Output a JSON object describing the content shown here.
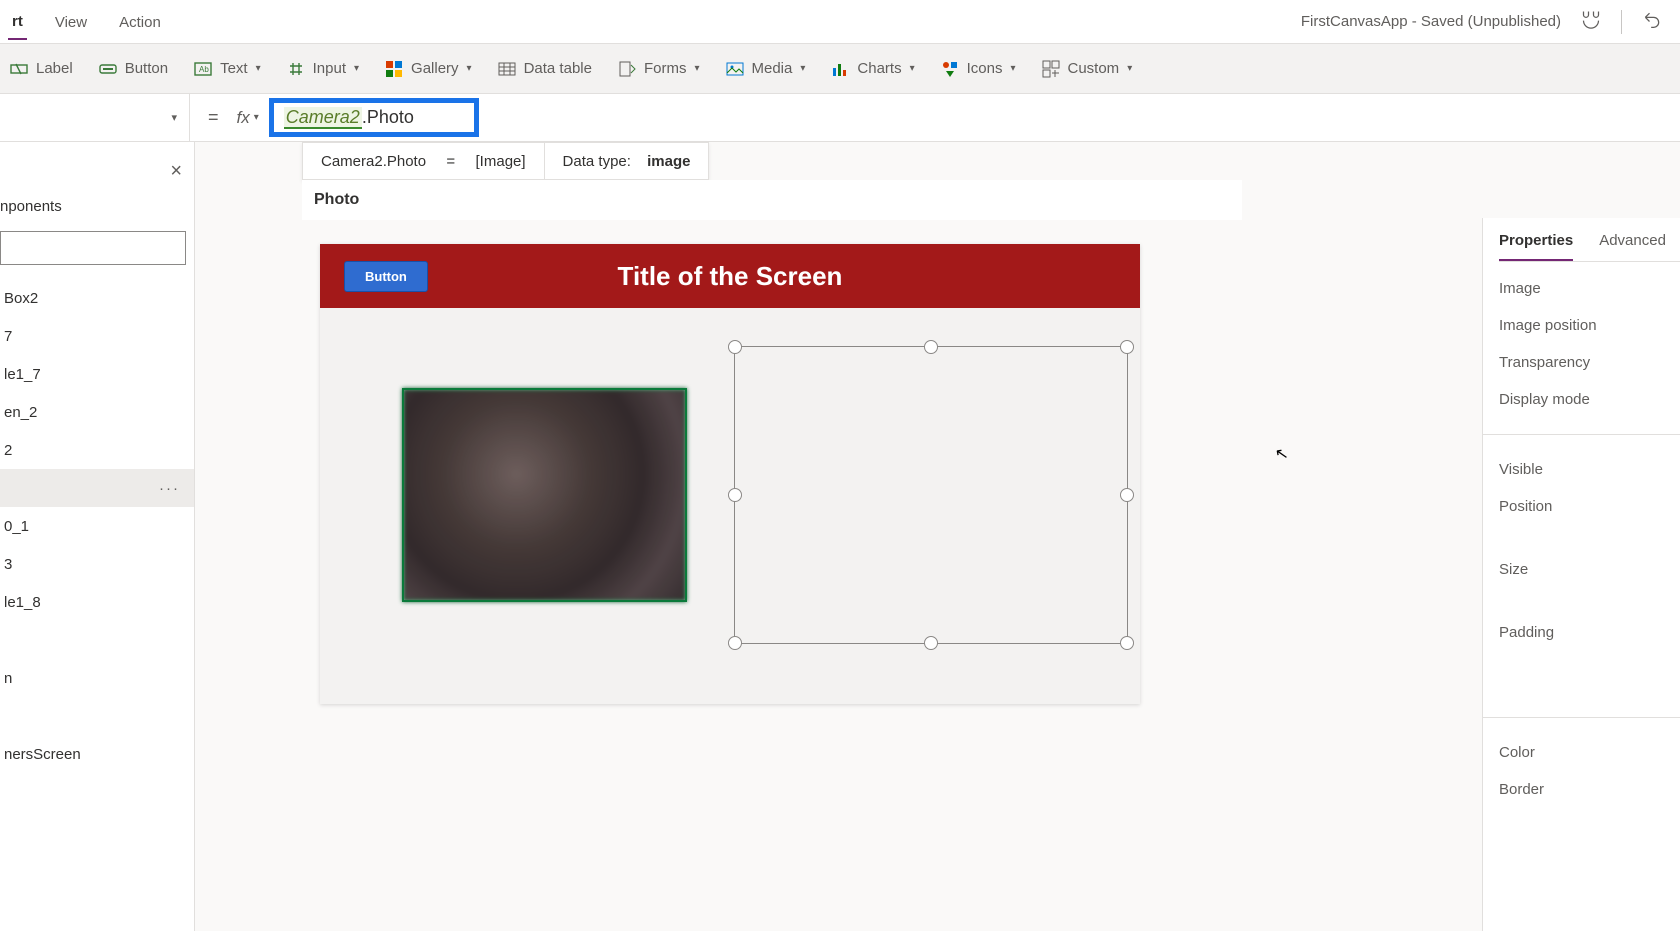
{
  "menubar": {
    "tabs": [
      "rt",
      "View",
      "Action"
    ],
    "app_title": "FirstCanvasApp - Saved (Unpublished)"
  },
  "ribbon": {
    "label": "Label",
    "button": "Button",
    "text": "Text",
    "input": "Input",
    "gallery": "Gallery",
    "datatable": "Data table",
    "forms": "Forms",
    "media": "Media",
    "charts": "Charts",
    "icons": "Icons",
    "custom": "Custom"
  },
  "formula": {
    "equals": "=",
    "fx": "fx",
    "token_obj": "Camera2",
    "token_prop": ".Photo"
  },
  "intellisense": {
    "expr": "Camera2.Photo",
    "eq": "=",
    "result": "[Image]",
    "datatype_label": "Data type:",
    "datatype_value": "image"
  },
  "section_header": "Photo",
  "tree": {
    "tab_label": "nponents",
    "items": [
      "Box2",
      "7",
      "le1_7",
      "en_2",
      "2",
      "",
      "0_1",
      "3",
      "le1_8",
      "",
      "n",
      "",
      "nersScreen"
    ],
    "selected_index": 5
  },
  "canvas": {
    "screen_title": "Title of the Screen",
    "button_label": "Button"
  },
  "properties": {
    "tabs": {
      "properties": "Properties",
      "advanced": "Advanced"
    },
    "items_a": [
      "Image",
      "Image position",
      "Transparency",
      "Display mode"
    ],
    "items_b": [
      "Visible",
      "Position",
      "Size",
      "Padding"
    ],
    "items_c": [
      "Color",
      "Border"
    ]
  }
}
